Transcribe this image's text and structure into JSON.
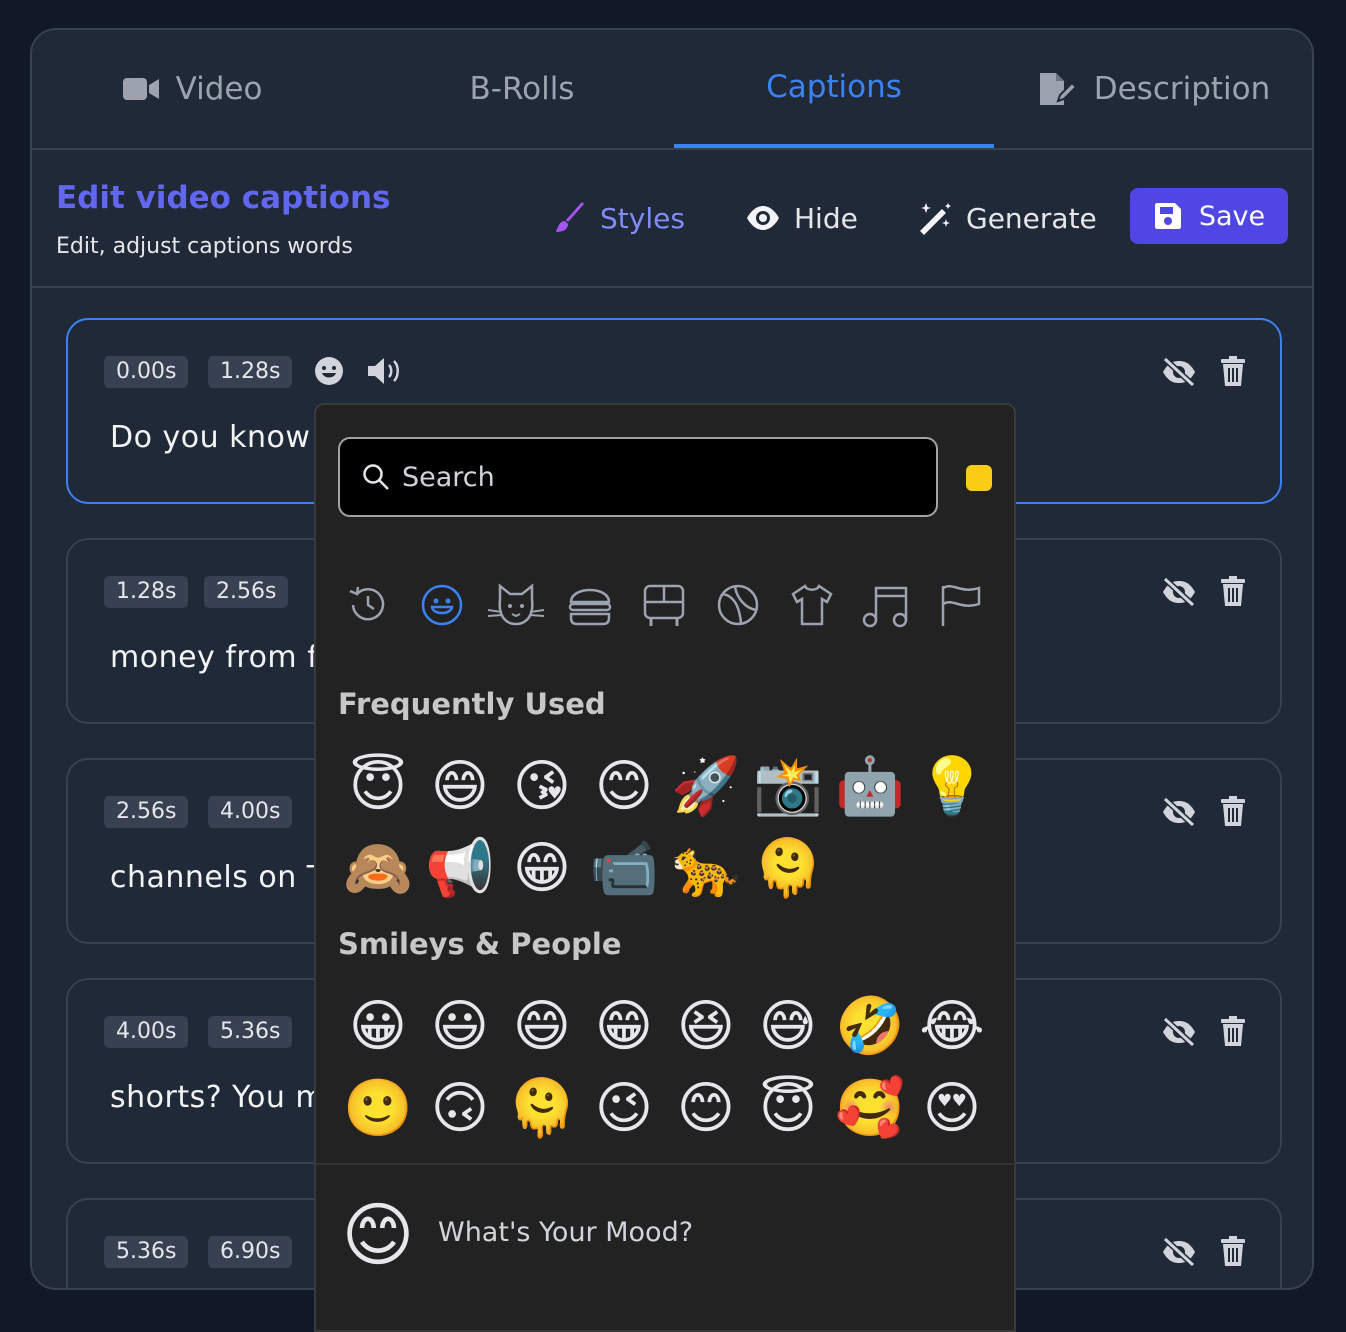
{
  "tabs": [
    {
      "label": "Video",
      "icon": "video-camera-icon"
    },
    {
      "label": "B-Rolls",
      "icon": ""
    },
    {
      "label": "Captions",
      "icon": ""
    },
    {
      "label": "Description",
      "icon": "file-edit-icon"
    }
  ],
  "active_tab": "Captions",
  "header": {
    "title": "Edit video captions",
    "subtitle": "Edit, adjust captions words",
    "styles_label": "Styles",
    "hide_label": "Hide",
    "generate_label": "Generate",
    "save_label": "Save"
  },
  "captions": [
    {
      "start": "0.00s",
      "end": "1.28s",
      "text": "Do you know"
    },
    {
      "start": "1.28s",
      "end": "2.56s",
      "text": "money from fa"
    },
    {
      "start": "2.56s",
      "end": "4.00s",
      "text": "channels on T"
    },
    {
      "start": "4.00s",
      "end": "5.36s",
      "text": "shorts? You m"
    },
    {
      "start": "5.36s",
      "end": "6.90s",
      "text": ""
    }
  ],
  "emoji_picker": {
    "search_placeholder": "Search",
    "skin_tone_color": "#facc15",
    "categories": [
      "recent-icon",
      "smiley-icon",
      "cat-icon",
      "burger-icon",
      "bus-icon",
      "ball-icon",
      "shirt-icon",
      "music-icon",
      "flag-icon"
    ],
    "frequently_used_label": "Frequently Used",
    "frequently_used": [
      "😇",
      "😄",
      "😘",
      "😊",
      "🚀",
      "📸",
      "🤖",
      "💡",
      "🙈",
      "📢",
      "😁",
      "📹",
      "🐆",
      "🫠"
    ],
    "smileys_label": "Smileys & People",
    "smileys": [
      "😀",
      "😃",
      "😄",
      "😁",
      "😆",
      "😅",
      "🤣",
      "😂",
      "🙂",
      "🙃",
      "🫠",
      "😉",
      "😊",
      "😇",
      "🥰",
      "😍"
    ],
    "footer_emoji": "😊",
    "footer_text": "What's Your Mood?"
  },
  "colors": {
    "accent": "#3b82f6",
    "primary": "#4f46e5",
    "background": "#111827",
    "panel": "#1f2937"
  }
}
